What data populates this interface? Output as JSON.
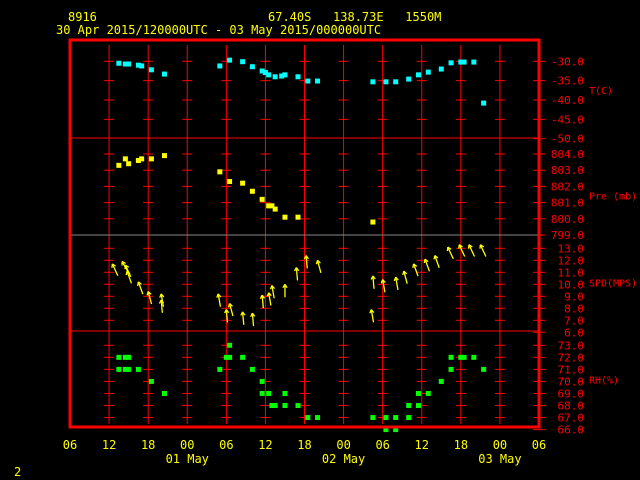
{
  "header": {
    "station": "8916",
    "location": "67.40S   138.73E   1550M",
    "period": "30 Apr 2015/120000UTC - 03 May 2015/000000UTC"
  },
  "page_number": "2",
  "colors": {
    "frame": "#ff0000",
    "temperature": "#00ffff",
    "pressure": "#ffff00",
    "wind": "#ffff00",
    "rh": "#00ff00",
    "text": "#ffff00",
    "axis_text": "#ff0000"
  },
  "chart_data": {
    "type": "multi-panel time series",
    "x_axis": {
      "range": [
        "2015-04-30 06:00",
        "2015-05-03 06:00"
      ],
      "tick_labels": [
        "06",
        "12",
        "18",
        "00",
        "06",
        "12",
        "18",
        "00",
        "06",
        "12",
        "18",
        "00",
        "06"
      ],
      "date_labels": [
        {
          "label": "01 May",
          "at": "2015-05-01 00:00"
        },
        {
          "label": "02 May",
          "at": "2015-05-02 00:00"
        },
        {
          "label": "03 May",
          "at": "2015-05-03 00:00"
        }
      ],
      "grid": true
    },
    "panels": [
      {
        "type": "scatter",
        "ylabel": "T(C)",
        "ylim": [
          -50,
          -30
        ],
        "yticks": [
          "-30.0",
          "-35.0",
          "-40.0",
          "-45.0",
          "-50.0"
        ],
        "ytick_values": [
          -30,
          -35,
          -40,
          -45,
          -50
        ],
        "color": "#00ffff",
        "points": [
          [
            "2015-04-30 13:30",
            -30.5
          ],
          [
            "2015-04-30 14:30",
            -30.7
          ],
          [
            "2015-04-30 15:00",
            -30.7
          ],
          [
            "2015-04-30 16:30",
            -31.0
          ],
          [
            "2015-04-30 17:00",
            -31.2
          ],
          [
            "2015-04-30 18:30",
            -32.2
          ],
          [
            "2015-04-30 20:30",
            -33.3
          ],
          [
            "2015-05-01 05:00",
            -31.2
          ],
          [
            "2015-05-01 06:30",
            -29.7
          ],
          [
            "2015-05-01 08:30",
            -30.1
          ],
          [
            "2015-05-01 10:00",
            -31.4
          ],
          [
            "2015-05-01 11:30",
            -32.5
          ],
          [
            "2015-05-01 12:00",
            -32.9
          ],
          [
            "2015-05-01 12:30",
            -33.5
          ],
          [
            "2015-05-01 13:30",
            -34.0
          ],
          [
            "2015-05-01 14:30",
            -33.8
          ],
          [
            "2015-05-01 15:00",
            -33.5
          ],
          [
            "2015-05-01 17:00",
            -34.0
          ],
          [
            "2015-05-01 18:30",
            -35.1
          ],
          [
            "2015-05-01 20:00",
            -35.1
          ],
          [
            "2015-05-02 04:30",
            -35.3
          ],
          [
            "2015-05-02 06:30",
            -35.3
          ],
          [
            "2015-05-02 08:00",
            -35.3
          ],
          [
            "2015-05-02 10:00",
            -34.6
          ],
          [
            "2015-05-02 11:30",
            -33.5
          ],
          [
            "2015-05-02 13:00",
            -32.8
          ],
          [
            "2015-05-02 15:00",
            -32.0
          ],
          [
            "2015-05-02 16:30",
            -30.4
          ],
          [
            "2015-05-02 18:00",
            -30.2
          ],
          [
            "2015-05-02 18:30",
            -30.2
          ],
          [
            "2015-05-02 20:00",
            -30.2
          ],
          [
            "2015-05-02 21:30",
            -40.8
          ]
        ]
      },
      {
        "type": "scatter",
        "ylabel": "Pre (mb)",
        "ylim": [
          799,
          804
        ],
        "yticks": [
          "804.0",
          "803.0",
          "802.0",
          "801.0",
          "800.0",
          "799.0"
        ],
        "ytick_values": [
          804,
          803,
          802,
          801,
          800,
          799
        ],
        "color": "#ffff00",
        "points": [
          [
            "2015-04-30 13:30",
            803.3
          ],
          [
            "2015-04-30 14:30",
            803.7
          ],
          [
            "2015-04-30 15:00",
            803.4
          ],
          [
            "2015-04-30 16:30",
            803.6
          ],
          [
            "2015-04-30 17:00",
            803.7
          ],
          [
            "2015-04-30 18:30",
            803.7
          ],
          [
            "2015-04-30 20:30",
            803.9
          ],
          [
            "2015-05-01 05:00",
            802.9
          ],
          [
            "2015-05-01 06:30",
            802.3
          ],
          [
            "2015-05-01 08:30",
            802.2
          ],
          [
            "2015-05-01 10:00",
            801.7
          ],
          [
            "2015-05-01 11:30",
            801.2
          ],
          [
            "2015-05-01 12:30",
            800.8
          ],
          [
            "2015-05-01 13:00",
            800.8
          ],
          [
            "2015-05-01 13:30",
            800.6
          ],
          [
            "2015-05-01 15:00",
            800.1
          ],
          [
            "2015-05-01 17:00",
            800.1
          ],
          [
            "2015-05-02 04:30",
            799.8
          ]
        ]
      },
      {
        "type": "vector",
        "ylabel": "SPD(MPS)",
        "ylim": [
          6,
          13
        ],
        "yticks": [
          "13.0",
          "12.0",
          "11.0",
          "10.0",
          "9.0",
          "8.0",
          "7.0",
          "6.0"
        ],
        "ytick_values": [
          13,
          12,
          11,
          10,
          9,
          8,
          7,
          6
        ],
        "color": "#ffff00",
        "points": [
          [
            "2015-04-30 12:30",
            11.7,
            335
          ],
          [
            "2015-04-30 14:00",
            11.9,
            330
          ],
          [
            "2015-04-30 14:30",
            11.6,
            335
          ],
          [
            "2015-04-30 14:45",
            11.1,
            340
          ],
          [
            "2015-04-30 16:30",
            10.2,
            340
          ],
          [
            "2015-04-30 18:00",
            9.4,
            345
          ],
          [
            "2015-04-30 20:00",
            9.2,
            350
          ],
          [
            "2015-04-30 20:00",
            8.7,
            355
          ],
          [
            "2015-05-01 04:45",
            9.2,
            350
          ],
          [
            "2015-05-01 06:00",
            7.9,
            355
          ],
          [
            "2015-05-01 06:30",
            8.4,
            345
          ],
          [
            "2015-05-01 08:30",
            7.7,
            355
          ],
          [
            "2015-05-01 10:00",
            7.6,
            355
          ],
          [
            "2015-05-01 11:30",
            9.1,
            355
          ],
          [
            "2015-05-01 12:30",
            9.3,
            350
          ],
          [
            "2015-05-01 13:00",
            9.9,
            350
          ],
          [
            "2015-05-01 15:00",
            10.0,
            0
          ],
          [
            "2015-05-01 16:45",
            11.4,
            355
          ],
          [
            "2015-05-01 18:15",
            12.4,
            355
          ],
          [
            "2015-05-01 20:00",
            12.0,
            345
          ],
          [
            "2015-05-02 04:15",
            7.9,
            350
          ],
          [
            "2015-05-02 04:30",
            10.7,
            355
          ],
          [
            "2015-05-02 06:00",
            10.4,
            350
          ],
          [
            "2015-05-02 08:00",
            10.6,
            350
          ],
          [
            "2015-05-02 09:15",
            11.1,
            345
          ],
          [
            "2015-05-02 10:45",
            11.7,
            340
          ],
          [
            "2015-05-02 12:30",
            12.1,
            340
          ],
          [
            "2015-05-02 14:00",
            12.4,
            340
          ],
          [
            "2015-05-02 16:00",
            13.1,
            335
          ],
          [
            "2015-05-02 17:45",
            13.3,
            335
          ],
          [
            "2015-05-02 19:15",
            13.3,
            335
          ],
          [
            "2015-05-02 21:00",
            13.3,
            335
          ]
        ]
      },
      {
        "type": "scatter",
        "ylabel": "RH(%)",
        "ylim": [
          66,
          73
        ],
        "yticks": [
          "73.0",
          "72.0",
          "71.0",
          "70.0",
          "69.0",
          "68.0",
          "67.0",
          "66.0"
        ],
        "ytick_values": [
          73,
          72,
          71,
          70,
          69,
          68,
          67,
          66
        ],
        "color": "#00ff00",
        "points": [
          [
            "2015-04-30 13:30",
            72
          ],
          [
            "2015-04-30 14:30",
            72
          ],
          [
            "2015-04-30 15:00",
            72
          ],
          [
            "2015-04-30 13:30",
            71
          ],
          [
            "2015-04-30 14:30",
            71
          ],
          [
            "2015-04-30 15:00",
            71
          ],
          [
            "2015-04-30 16:30",
            71
          ],
          [
            "2015-04-30 18:30",
            70
          ],
          [
            "2015-04-30 20:30",
            69
          ],
          [
            "2015-05-01 05:00",
            71
          ],
          [
            "2015-05-01 06:00",
            72
          ],
          [
            "2015-05-01 06:30",
            72
          ],
          [
            "2015-05-01 06:30",
            73
          ],
          [
            "2015-05-01 08:30",
            72
          ],
          [
            "2015-05-01 10:00",
            71
          ],
          [
            "2015-05-01 11:30",
            70
          ],
          [
            "2015-05-01 11:30",
            69
          ],
          [
            "2015-05-01 12:30",
            69
          ],
          [
            "2015-05-01 13:00",
            68
          ],
          [
            "2015-05-01 13:30",
            68
          ],
          [
            "2015-05-01 15:00",
            68
          ],
          [
            "2015-05-01 15:00",
            69
          ],
          [
            "2015-05-01 17:00",
            68
          ],
          [
            "2015-05-01 18:30",
            67
          ],
          [
            "2015-05-01 20:00",
            67
          ],
          [
            "2015-05-02 04:30",
            67
          ],
          [
            "2015-05-02 06:30",
            67
          ],
          [
            "2015-05-02 06:30",
            66
          ],
          [
            "2015-05-02 08:00",
            67
          ],
          [
            "2015-05-02 08:00",
            66
          ],
          [
            "2015-05-02 10:00",
            67
          ],
          [
            "2015-05-02 10:00",
            68
          ],
          [
            "2015-05-02 11:30",
            68
          ],
          [
            "2015-05-02 11:30",
            69
          ],
          [
            "2015-05-02 13:00",
            69
          ],
          [
            "2015-05-02 15:00",
            70
          ],
          [
            "2015-05-02 16:30",
            71
          ],
          [
            "2015-05-02 16:30",
            72
          ],
          [
            "2015-05-02 18:00",
            72
          ],
          [
            "2015-05-02 18:30",
            72
          ],
          [
            "2015-05-02 20:00",
            72
          ],
          [
            "2015-05-02 21:30",
            71
          ]
        ]
      }
    ]
  }
}
